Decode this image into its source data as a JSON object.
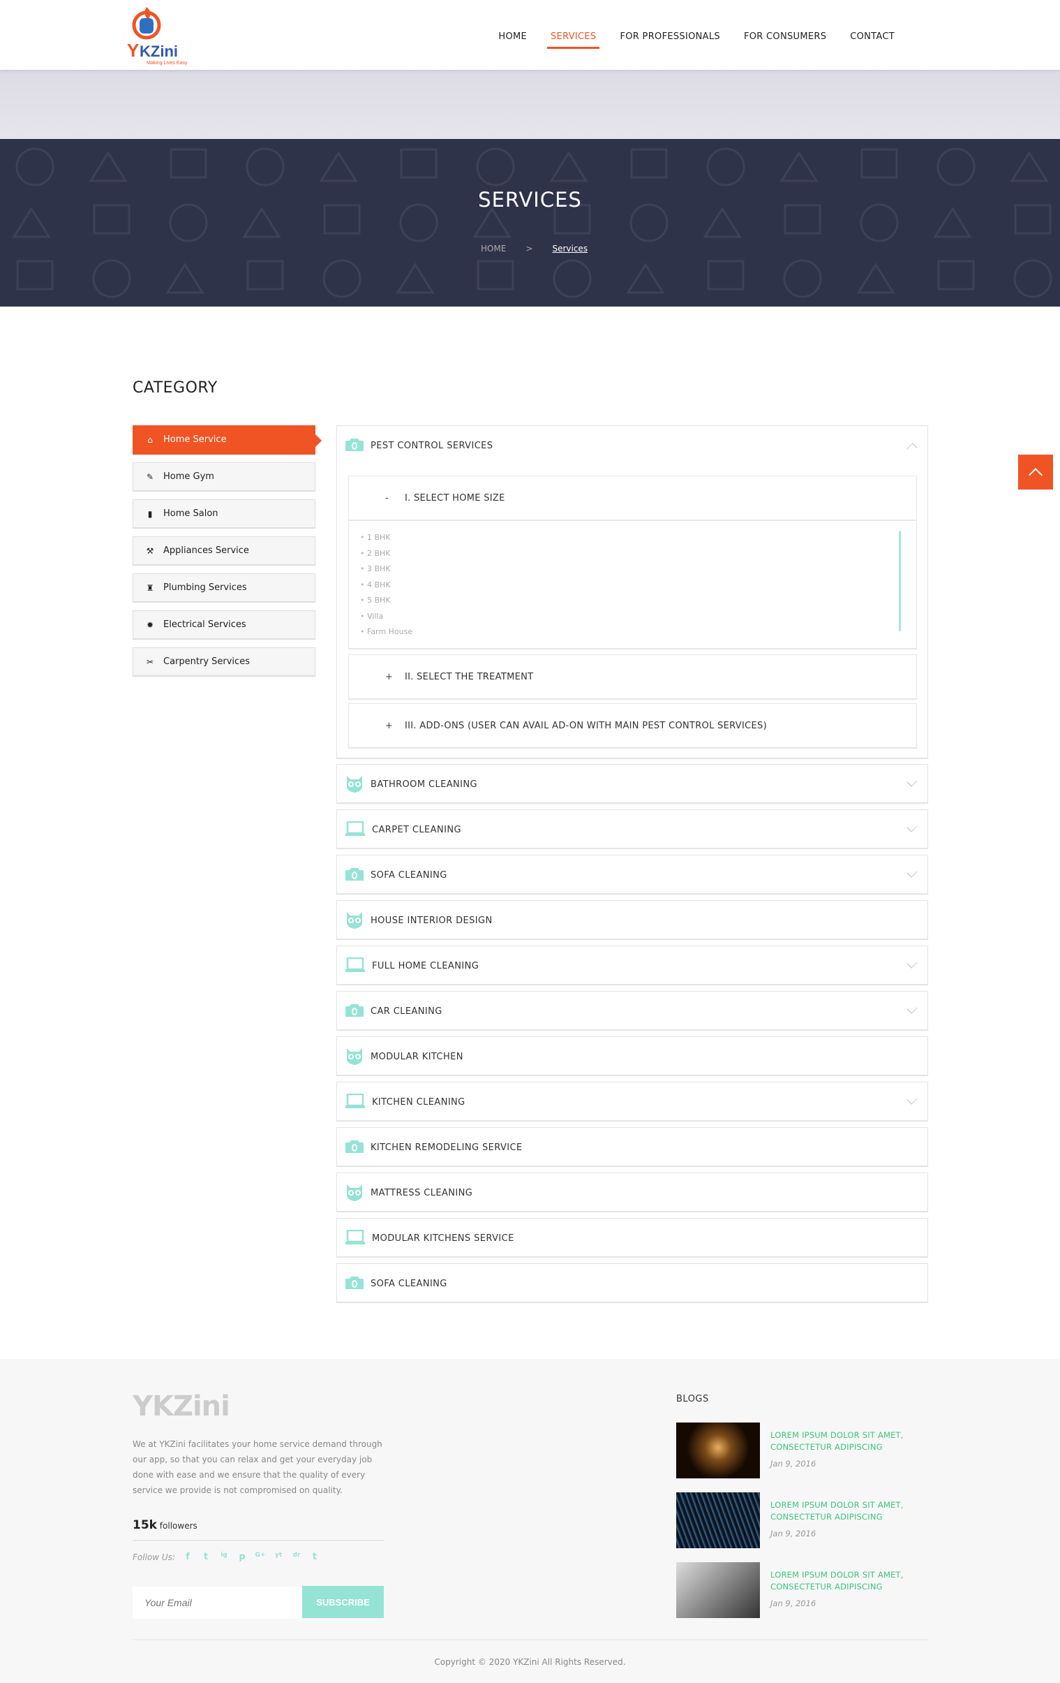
{
  "header": {
    "logo_alt": "YKZini - Making Lives Easy",
    "nav": [
      {
        "label": "HOME"
      },
      {
        "label": "SERVICES",
        "active": true
      },
      {
        "label": "FOR PROFESSIONALS"
      },
      {
        "label": "FOR CONSUMERS"
      },
      {
        "label": "CONTACT"
      }
    ]
  },
  "hero": {
    "title": "SERVICES",
    "breadcrumb": {
      "home": "HOME",
      "sep": ">",
      "current": "Services"
    }
  },
  "category": {
    "title": "CATEGORY",
    "items": [
      {
        "label": "Home Service",
        "icon": "home-icon"
      },
      {
        "label": "Home Gym",
        "icon": "dumbbell-icon"
      },
      {
        "label": "Home Salon",
        "icon": "salon-icon"
      },
      {
        "label": "Appliances Service",
        "icon": "wrench-icon"
      },
      {
        "label": "Plumbing Services",
        "icon": "plumbing-icon"
      },
      {
        "label": "Electrical Services",
        "icon": "bulb-icon"
      },
      {
        "label": "Carpentry Services",
        "icon": "tools-icon"
      }
    ]
  },
  "services": {
    "open": {
      "title": "PEST CONTROL SERVICES",
      "sub": [
        {
          "sign": "-",
          "title": "I. SELECT HOME SIZE",
          "options": [
            "1 BHK",
            "2 BHK",
            "3 BHK",
            "4 BHK",
            "5 BHK",
            "Villa",
            "Farm House"
          ]
        },
        {
          "sign": "+",
          "title": "II. SELECT THE TREATMENT"
        },
        {
          "sign": "+",
          "title": "III. ADD-ONS (USER CAN AVAIL AD-ON WITH MAIN PEST CONTROL SERVICES)"
        }
      ]
    },
    "items": [
      {
        "title": "BATHROOM CLEANING",
        "icon": "owl",
        "chevron": true
      },
      {
        "title": "CARPET CLEANING",
        "icon": "laptop",
        "chevron": true
      },
      {
        "title": "SOFA CLEANING",
        "icon": "camera",
        "chevron": true
      },
      {
        "title": "HOUSE INTERIOR DESIGN",
        "icon": "owl",
        "chevron": false
      },
      {
        "title": "FULL HOME CLEANING",
        "icon": "laptop",
        "chevron": true
      },
      {
        "title": "CAR CLEANING",
        "icon": "camera",
        "chevron": true
      },
      {
        "title": "MODULAR KITCHEN",
        "icon": "owl",
        "chevron": false
      },
      {
        "title": "KITCHEN CLEANING",
        "icon": "laptop",
        "chevron": true
      },
      {
        "title": "KITCHEN REMODELING SERVICE",
        "icon": "camera",
        "chevron": false
      },
      {
        "title": "MATTRESS CLEANING",
        "icon": "owl",
        "chevron": false
      },
      {
        "title": "MODULAR KITCHENS SERVICE",
        "icon": "laptop",
        "chevron": false
      },
      {
        "title": "SOFA CLEANING",
        "icon": "camera",
        "chevron": false
      }
    ]
  },
  "footer": {
    "brand": "YKZini",
    "description": "We at YKZini facilitates your home service demand through our app, so that you can relax and get your everyday job done with ease and we ensure that the quality of every service we provide is not compromised on quality.",
    "followers_count": "15k",
    "followers_label": "followers",
    "follow_label": "Follow Us:",
    "social": [
      "f",
      "t",
      "ig",
      "p",
      "G+",
      "yt",
      "dr",
      "t"
    ],
    "email_placeholder": "Your Email",
    "subscribe": "SUBSCRIBE",
    "blogs_title": "BLOGS",
    "blogs": [
      {
        "title": "LOREM IPSUM DOLOR SIT AMET, CONSECTETUR ADIPISCING",
        "date": "Jan 9, 2016"
      },
      {
        "title": "LOREM IPSUM DOLOR SIT AMET, CONSECTETUR ADIPISCING",
        "date": "Jan 9, 2016"
      },
      {
        "title": "LOREM IPSUM DOLOR SIT AMET, CONSECTETUR ADIPISCING",
        "date": "Jan 9, 2016"
      }
    ],
    "copyright": "Copyright © 2020 YKZini All Rights Reserved."
  },
  "colors": {
    "accent": "#f05424",
    "teal": "#95e3d5",
    "hero": "#2f3349",
    "blog_link": "#3cc47c"
  }
}
